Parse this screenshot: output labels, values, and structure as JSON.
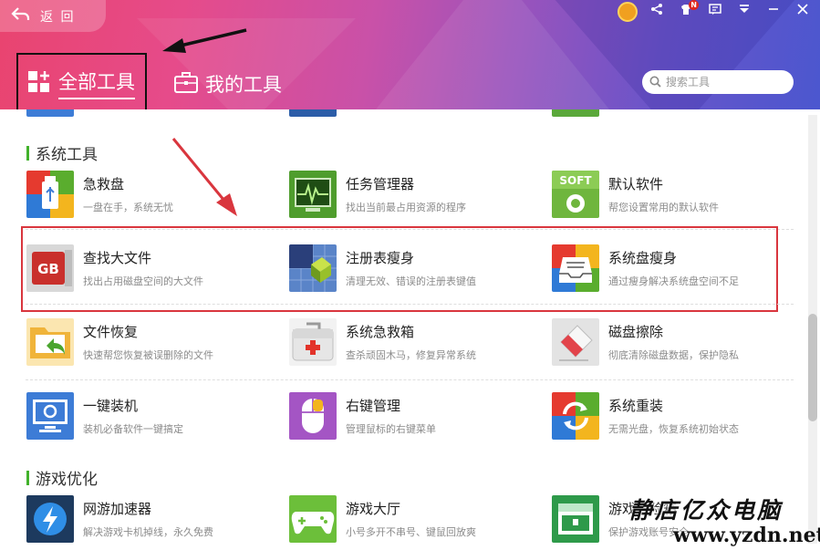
{
  "header": {
    "back_label": "返 回",
    "tabs": [
      {
        "label": "全部工具",
        "selected": true
      },
      {
        "label": "我的工具",
        "selected": false
      }
    ],
    "search_placeholder": "搜索工具",
    "notification_badge": "N"
  },
  "sections": [
    {
      "title": "系统工具",
      "rows": [
        [
          {
            "name": "急救盘",
            "desc": "一盘在手，系统无忧",
            "icon": "usb-rescue-icon"
          },
          {
            "name": "任务管理器",
            "desc": "找出当前最占用资源的程序",
            "icon": "task-monitor-icon"
          },
          {
            "name": "默认软件",
            "desc": "帮您设置常用的默认软件",
            "icon": "soft-settings-icon",
            "icon_text": "SOFT"
          }
        ],
        [
          {
            "name": "查找大文件",
            "desc": "找出占用磁盘空间的大文件",
            "icon": "large-file-icon",
            "icon_text": "GB"
          },
          {
            "name": "注册表瘦身",
            "desc": "清理无效、错误的注册表键值",
            "icon": "registry-cube-icon"
          },
          {
            "name": "系统盘瘦身",
            "desc": "通过瘦身解决系统盘空间不足",
            "icon": "disk-tray-icon"
          }
        ],
        [
          {
            "name": "文件恢复",
            "desc": "快速帮您恢复被误删除的文件",
            "icon": "folder-restore-icon"
          },
          {
            "name": "系统急救箱",
            "desc": "查杀顽固木马，修复异常系统",
            "icon": "first-aid-kit-icon"
          },
          {
            "name": "磁盘擦除",
            "desc": "彻底清除磁盘数据，保护隐私",
            "icon": "eraser-icon"
          }
        ],
        [
          {
            "name": "一键装机",
            "desc": "装机必备软件一键搞定",
            "icon": "monitor-install-icon"
          },
          {
            "name": "右键管理",
            "desc": "管理鼠标的右键菜单",
            "icon": "mouse-icon"
          },
          {
            "name": "系统重装",
            "desc": "无需光盘，恢复系统初始状态",
            "icon": "reinstall-cycle-icon"
          }
        ]
      ]
    },
    {
      "title": "游戏优化",
      "rows": [
        [
          {
            "name": "网游加速器",
            "desc": "解决游戏卡机掉线，永久免费",
            "icon": "lightning-icon"
          },
          {
            "name": "游戏大厅",
            "desc": "小号多开不串号、键鼠回放爽",
            "icon": "gamepad-icon"
          },
          {
            "name": "游戏保险箱",
            "desc": "保护游戏账号安全",
            "icon": "safe-box-icon"
          }
        ]
      ]
    }
  ],
  "watermark": {
    "text_cn": "静店亿众电脑",
    "url": "www.yzdn.net"
  },
  "colors": {
    "accent_green": "#42b22c",
    "highlight_red": "#d9363e"
  }
}
